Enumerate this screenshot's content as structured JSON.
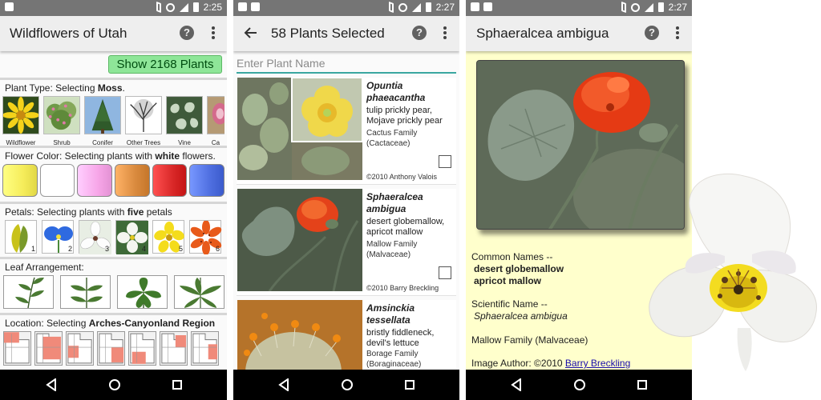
{
  "status": {
    "time_1": "2:25",
    "time_2": "2:27",
    "time_3": "2:27"
  },
  "screen1": {
    "title": "Wildflowers of Utah",
    "show_button": "Show 2168 Plants",
    "plant_type": {
      "prefix": "Plant Type: Selecting ",
      "value": "Moss",
      "suffix": ".",
      "items": [
        {
          "label": "Wildflower"
        },
        {
          "label": "Shrub"
        },
        {
          "label": "Conifer"
        },
        {
          "label": "Other Trees"
        },
        {
          "label": "Vine"
        },
        {
          "label": "Ca"
        }
      ]
    },
    "flower_color": {
      "prefix": "Flower Color: Selecting plants with ",
      "value": "white",
      "suffix": " flowers.",
      "swatches": [
        "#f5ec5a",
        "#ffffff",
        "#f7a6e8",
        "#d98a3e",
        "#d92828",
        "#4f6fe0"
      ]
    },
    "petals": {
      "prefix": "Petals: Selecting plants with ",
      "value": "five",
      "suffix": " petals",
      "items": [
        {
          "num": "1"
        },
        {
          "num": "2"
        },
        {
          "num": "3"
        },
        {
          "num": "4"
        },
        {
          "num": "5"
        },
        {
          "num": "6"
        }
      ]
    },
    "leaf": {
      "label": "Leaf Arrangement:"
    },
    "location": {
      "prefix": "Location: Selecting ",
      "value": "Arches-Canyonland Region"
    }
  },
  "screen2": {
    "title": "58 Plants Selected",
    "search_placeholder": "Enter Plant Name",
    "plants": [
      {
        "scientific": "Opuntia phaeacantha",
        "common": "tulip prickly pear, Mojave prickly pear",
        "family": "Cactus Family (Cactaceae)",
        "credit": "©2010 Anthony Valois"
      },
      {
        "scientific": "Sphaeralcea ambigua",
        "common": "desert globemallow, apricot mallow",
        "family": "Mallow Family (Malvaceae)",
        "credit": "©2010 Barry Breckling"
      },
      {
        "scientific": "Amsinckia tessellata",
        "common": "bristly fiddleneck, devil's lettuce",
        "family": "Borage Family (Boraginaceae)",
        "credit": ""
      }
    ]
  },
  "screen3": {
    "title": "Sphaeralcea ambigua",
    "common_names_label": "Common Names --",
    "common_name_1": "desert globemallow",
    "common_name_2": "apricot mallow",
    "scientific_label": "Scientific Name --",
    "scientific_name": "Sphaeralcea ambigua",
    "family": "Mallow Family (Malvaceae)",
    "image_author_label": "Image Author: ©2010 ",
    "image_author_link": "Barry Breckling"
  },
  "colors": {
    "status_bar": "#757575",
    "app_bar": "#eeeeee",
    "show_button": "#8ee698",
    "accent_teal": "#3aa7a0",
    "detail_bg": "#ffffcc"
  }
}
